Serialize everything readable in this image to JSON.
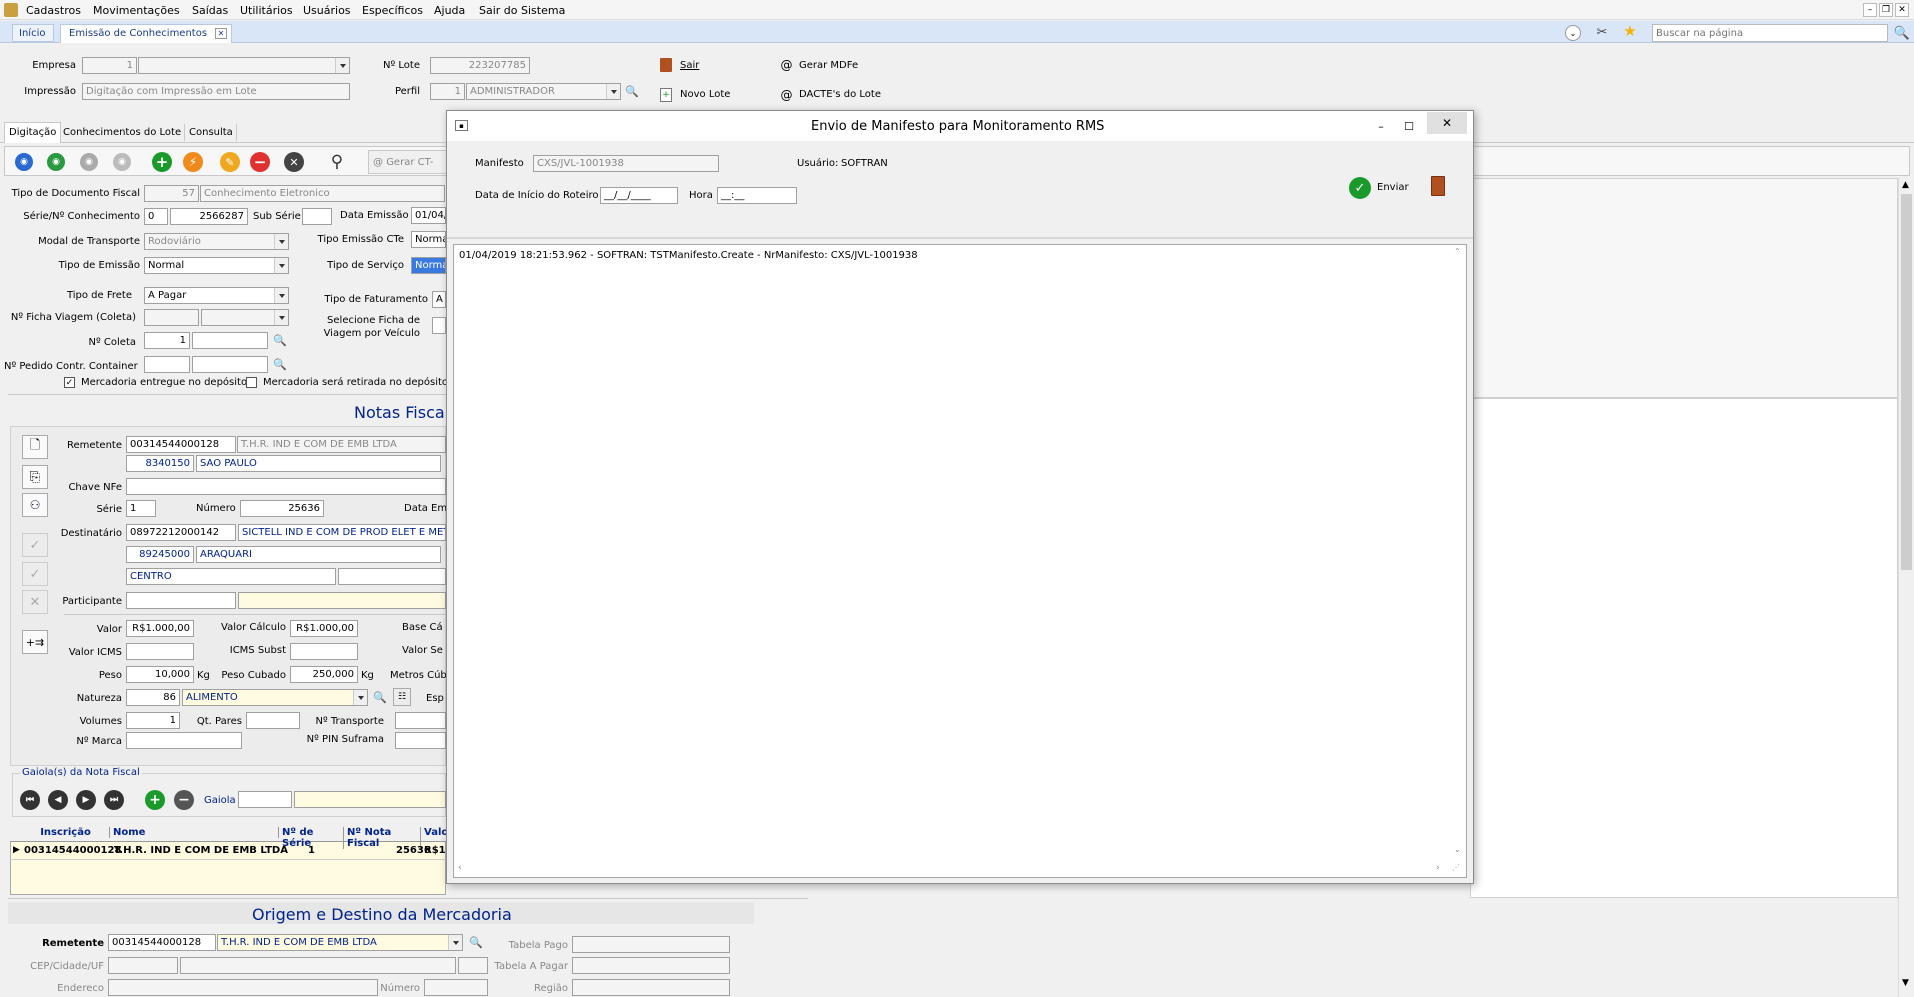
{
  "menu": {
    "items": [
      "Cadastros",
      "Movimentações",
      "Saídas",
      "Utilitários",
      "Usuários",
      "Específicos",
      "Ajuda",
      "Sair do Sistema"
    ]
  },
  "tabs": {
    "home": "Início",
    "active": "Emissão de Conhecimentos"
  },
  "search": {
    "placeholder": "Buscar na página"
  },
  "header": {
    "empresa_label": "Empresa",
    "empresa_code": "1",
    "impressao_label": "Impressão",
    "impressao_value": "Digitação com Impressão em Lote",
    "lote_label": "Nº Lote",
    "lote_value": "223207785",
    "perfil_label": "Perfil",
    "perfil_code": "1",
    "perfil_value": "ADMINISTRADOR",
    "sair": "Sair",
    "novo_lote": "Novo Lote",
    "gerar_mdfe": "Gerar MDFe",
    "dacte_lote": "DACTE's do Lote"
  },
  "subtabs": [
    "Digitação",
    "Conhecimentos do Lote",
    "Consulta"
  ],
  "toolbar": {
    "gerar": "Gerar CT-"
  },
  "form": {
    "tipo_doc_label": "Tipo de Documento Fiscal",
    "tipo_doc_code": "57",
    "tipo_doc_value": "Conhecimento Eletronico",
    "serie_label": "Série/Nº Conhecimento",
    "serie_value": "0",
    "conh_value": "2566287",
    "sub_serie_label": "Sub Série",
    "data_emissao_label": "Data Emissão",
    "data_emissao_value": "01/04/",
    "modal_label": "Modal de Transporte",
    "modal_value": "Rodoviário",
    "tipo_emissao_cte_label": "Tipo Emissão CTe",
    "tipo_emissao_cte_value": "Normal",
    "tipo_emissao_label": "Tipo de Emissão",
    "tipo_emissao_value": "Normal",
    "tipo_servico_label": "Tipo de Serviço",
    "tipo_servico_value": "Norma",
    "tipo_frete_label": "Tipo de Frete",
    "tipo_frete_value": "A Pagar",
    "tipo_fat_label": "Tipo de Faturamento",
    "tipo_fat_value": "A",
    "ficha_label": "Nº Ficha Viagem (Coleta)",
    "sel_ficha_label1": "Selecione Ficha de",
    "sel_ficha_label2": "Viagem por Veículo",
    "coleta_label": "Nº Coleta",
    "coleta_value": "1",
    "pedido_label": "Nº Pedido Contr. Container",
    "chk1": "Mercadoria entregue no depósito",
    "chk2": "Mercadoria será retirada no depósito"
  },
  "notas": {
    "title": "Notas Fisca",
    "remetente_label": "Remetente",
    "remetente_cnpj": "00314544000128",
    "remetente_nome": "T.H.R. IND E COM DE EMB LTDA",
    "rem_cod": "8340150",
    "rem_cidade": "SAO PAULO",
    "chave_label": "Chave NFe",
    "serie_label": "Série",
    "serie_value": "1",
    "numero_label": "Número",
    "numero_value": "25636",
    "data_em_label": "Data Em",
    "dest_label": "Destinatário",
    "dest_cnpj": "08972212000142",
    "dest_nome": "SICTELL IND E COM DE PROD ELET E META",
    "dest_cod": "89245000",
    "dest_cidade": "ARAQUARI",
    "dest_bairro": "CENTRO",
    "participante_label": "Participante",
    "valor_label": "Valor",
    "valor_value": "R$1.000,00",
    "valor_calc_label": "Valor Cálculo",
    "valor_calc_value": "R$1.000,00",
    "base_label": "Base Cá",
    "icms_label": "Valor ICMS",
    "icms_subst_label": "ICMS Subst",
    "valor_se_label": "Valor Se",
    "peso_label": "Peso",
    "peso_value": "10,000",
    "kg1": "Kg",
    "peso_cub_label": "Peso Cubado",
    "peso_cub_value": "250,000",
    "kg2": "Kg",
    "metros_label": "Metros Cúb",
    "natureza_label": "Natureza",
    "natureza_code": "86",
    "natureza_value": "ALIMENTO",
    "esp_label": "Esp",
    "volumes_label": "Volumes",
    "volumes_value": "1",
    "qt_pares_label": "Qt. Pares",
    "transporte_label": "Nº Transporte",
    "marca_label": "Nº Marca",
    "pin_label": "Nº PIN Suframa"
  },
  "gaiola": {
    "title": "Gaiola(s) da Nota Fiscal",
    "label": "Gaiola"
  },
  "grid": {
    "headers": [
      "Inscrição",
      "Nome",
      "Nº de Série",
      "Nº Nota Fiscal",
      "Valo"
    ],
    "rows": [
      [
        "00314544000128",
        "T.H.R. IND E COM DE EMB LTDA",
        "1",
        "25636",
        "R$1"
      ]
    ]
  },
  "origem": {
    "title": "Origem e Destino da Mercadoria",
    "remetente_label": "Remetente",
    "remetente_cnpj": "00314544000128",
    "remetente_nome": "T.H.R. IND E COM DE EMB LTDA",
    "cep_label": "CEP/Cidade/UF",
    "endereco_label": "Endereco",
    "numero_label": "Número",
    "tabela_pago_label": "Tabela Pago",
    "tabela_apagar_label": "Tabela A Pagar",
    "regiao_label": "Região"
  },
  "dialog": {
    "title": "Envio de Manifesto para Monitoramento RMS",
    "manifesto_label": "Manifesto",
    "manifesto_value": "CXS/JVL-1001938",
    "usuario_label": "Usuário:",
    "usuario_value": "SOFTRAN",
    "data_label": "Data de Início do Roteiro",
    "data_value": "__/__/____",
    "hora_label": "Hora",
    "hora_value": "__:__",
    "enviar": "Enviar",
    "log": "01/04/2019 18:21:53.962 - SOFTRAN: TSTManifesto.Create - NrManifesto: CXS/JVL-1001938"
  },
  "colors": {
    "accent": "#00238c",
    "green": "#1a9a2a",
    "orange": "#f08a1a",
    "red": "#e03030",
    "tabbar": "#d9e6f7"
  }
}
